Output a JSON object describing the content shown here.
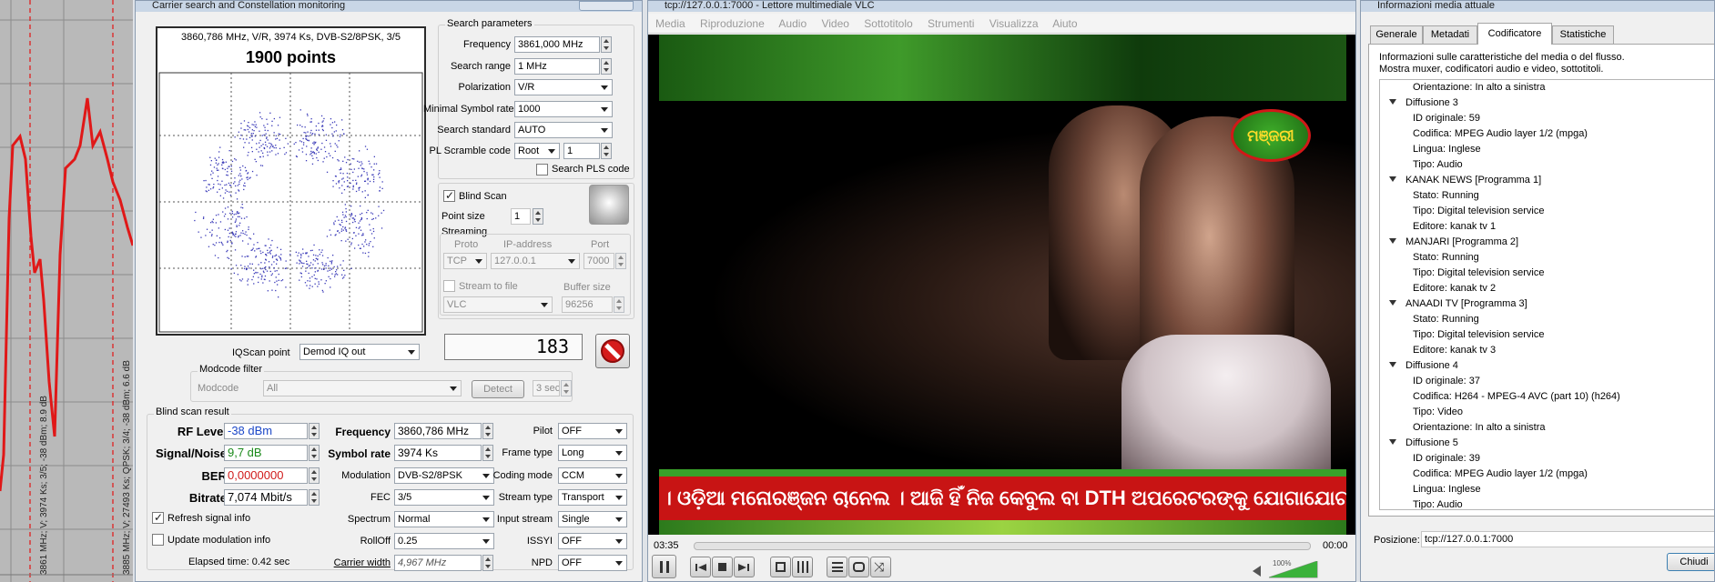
{
  "spectrum": {
    "marker1": "3861 MHz; V; 3974 Ks; 3/5; -38 dBm; 8.9 dB",
    "marker2": "3885 MHz; V; 27493 Ks; QPSK; 3/4; -38 dBm; 6.6 dB"
  },
  "carrier": {
    "title": "Carrier search and Constellation monitoring",
    "constellation": {
      "header": "3860,786 MHz, V/R, 3974 Ks, DVB-S2/8PSK, 3/5",
      "points": "1900 points"
    },
    "search": {
      "group": "Search parameters",
      "frequency_label": "Frequency",
      "frequency": "3861,000 MHz",
      "range_label": "Search range",
      "range": "1 MHz",
      "polarization_label": "Polarization",
      "polarization": "V/R",
      "minsr_label": "Minimal Symbol rate",
      "minsr": "1000",
      "standard_label": "Search standard",
      "standard": "AUTO",
      "pls_label": "PL Scramble code",
      "pls_mode": "Root",
      "pls_value": "1",
      "search_pls": "Search PLS code"
    },
    "blind_scan": "Blind Scan",
    "point_size_label": "Point size",
    "point_size": "1",
    "streaming": {
      "group": "Streaming",
      "proto_label": "Proto",
      "ip_label": "IP-address",
      "port_label": "Port",
      "proto": "TCP",
      "ip": "127.0.0.1",
      "port": "7000",
      "stream_to_file": "Stream to file",
      "buffer_label": "Buffer size",
      "player": "VLC",
      "buffer": "96256"
    },
    "counter": "183",
    "iqscan_label": "IQScan point",
    "iqscan": "Demod IQ out",
    "modcode": {
      "group": "Modcode filter",
      "label": "Modcode",
      "value": "All",
      "detect": "Detect",
      "time": "3 sec"
    },
    "result": {
      "group": "Blind scan result",
      "rf_label": "RF Level",
      "rf": "-38 dBm",
      "sn_label": "Signal/Noise",
      "sn": "9,7 dB",
      "ber_label": "BER",
      "ber": "0,0000000",
      "bitrate_label": "Bitrate",
      "bitrate": "7,074 Mbit/s",
      "freq_label": "Frequency",
      "freq": "3860,786 MHz",
      "sr_label": "Symbol rate",
      "sr": "3974 Ks",
      "mod_label": "Modulation",
      "mod": "DVB-S2/8PSK",
      "fec_label": "FEC",
      "fec": "3/5",
      "spectrum_label": "Spectrum",
      "spectrum": "Normal",
      "rolloff_label": "RollOff",
      "rolloff": "0.25",
      "cw_label": "Carrier width",
      "cw": "4,967 MHz",
      "pilot_label": "Pilot",
      "pilot": "OFF",
      "frame_label": "Frame type",
      "frame": "Long",
      "coding_label": "Coding mode",
      "coding": "CCM",
      "streamtype_label": "Stream type",
      "streamtype": "Transport",
      "input_label": "Input stream",
      "input": "Single",
      "issyi_label": "ISSYI",
      "issyi": "OFF",
      "npd_label": "NPD",
      "npd": "OFF",
      "refresh": "Refresh signal info",
      "update_mod": "Update modulation info",
      "elapsed": "Elapsed time: 0.42 sec"
    }
  },
  "vlc": {
    "title": "tcp://127.0.0.1:7000 - Lettore multimediale VLC",
    "menu": [
      "Media",
      "Riproduzione",
      "Audio",
      "Video",
      "Sottotitolo",
      "Strumenti",
      "Visualizza",
      "Aiuto"
    ],
    "logo": "ମଞ୍ଜରୀ",
    "ticker": "। ଓଡ଼ିଆ ମନୋରଞ୍ଜନ ଚାନେଲ । ଆଜି ହିଁ ନିଜ କେବୁଲ ବା DTH ଅପରେଟରଙ୍କୁ ଯୋଗାଯୋଗ",
    "time_elapsed": "03:35",
    "time_total": "00:00",
    "volume": "100%",
    "volume_level": 1.0,
    "progress": 0.0
  },
  "media_info": {
    "title": "Informazioni media attuale",
    "tabs": [
      "Generale",
      "Metadati",
      "Codificatore",
      "Statistiche"
    ],
    "desc1": "Informazioni sulle caratteristiche del media o del flusso.",
    "desc2": "Mostra muxer, codificatori audio e video, sottotitoli.",
    "tree": [
      {
        "t": "Orientazione: In alto a sinistra",
        "l": 2
      },
      {
        "t": "Diffusione 3",
        "l": 1
      },
      {
        "t": "ID originale: 59",
        "l": 2
      },
      {
        "t": "Codifica: MPEG Audio layer 1/2 (mpga)",
        "l": 2
      },
      {
        "t": "Lingua: Inglese",
        "l": 2
      },
      {
        "t": "Tipo: Audio",
        "l": 2
      },
      {
        "t": "KANAK NEWS [Programma 1]",
        "l": 1
      },
      {
        "t": "Stato: Running",
        "l": 2
      },
      {
        "t": "Tipo: Digital television service",
        "l": 2
      },
      {
        "t": "Editore: kanak tv 1",
        "l": 2
      },
      {
        "t": "MANJARI [Programma 2]",
        "l": 1
      },
      {
        "t": "Stato: Running",
        "l": 2
      },
      {
        "t": "Tipo: Digital television service",
        "l": 2
      },
      {
        "t": "Editore: kanak tv 2",
        "l": 2
      },
      {
        "t": "ANAADI TV [Programma 3]",
        "l": 1
      },
      {
        "t": "Stato: Running",
        "l": 2
      },
      {
        "t": "Tipo: Digital television service",
        "l": 2
      },
      {
        "t": "Editore: kanak tv 3",
        "l": 2
      },
      {
        "t": "Diffusione 4",
        "l": 1
      },
      {
        "t": "ID originale: 37",
        "l": 2
      },
      {
        "t": "Codifica: H264 - MPEG-4 AVC (part 10) (h264)",
        "l": 2
      },
      {
        "t": "Tipo: Video",
        "l": 2
      },
      {
        "t": "Orientazione: In alto a sinistra",
        "l": 2
      },
      {
        "t": "Diffusione 5",
        "l": 1
      },
      {
        "t": "ID originale: 39",
        "l": 2
      },
      {
        "t": "Codifica: MPEG Audio layer 1/2 (mpga)",
        "l": 2
      },
      {
        "t": "Lingua: Inglese",
        "l": 2
      },
      {
        "t": "Tipo: Audio",
        "l": 2
      }
    ],
    "pos_label": "Posizione:",
    "pos": "tcp://127.0.0.1:7000",
    "close": "Chiudi"
  }
}
